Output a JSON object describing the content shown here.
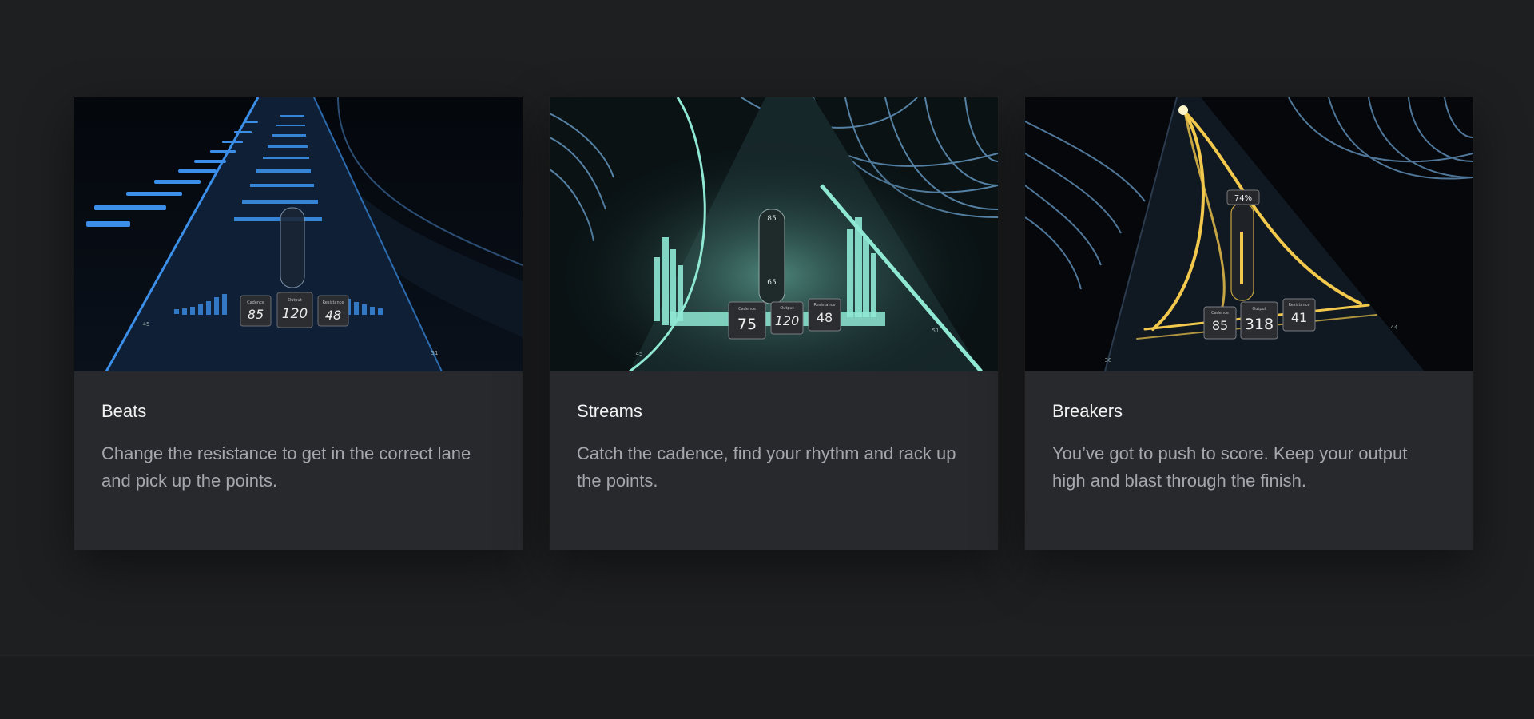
{
  "accent": {
    "beats": "#3b8fe8",
    "streams": "#8fe8d4",
    "breakers": "#f2c94c"
  },
  "cards": [
    {
      "title": "Beats",
      "description": "Change the resistance to get in the correct lane and pick up the points.",
      "hud": {
        "cadence_label": "Cadence",
        "cadence": "85",
        "output_label": "Output",
        "output": "120",
        "resistance_label": "Resistance",
        "resistance": "48",
        "marker_left": "45",
        "marker_right": "51"
      }
    },
    {
      "title": "Streams",
      "description": "Catch the cadence, find your rhythm and rack up the points.",
      "hud": {
        "cadence_label": "Cadence",
        "cadence": "75",
        "output_label": "Output",
        "output": "120",
        "resistance_label": "Resistance",
        "resistance": "48",
        "gauge_top": "85",
        "gauge_bottom": "65",
        "marker_left": "45",
        "marker_right": "51"
      }
    },
    {
      "title": "Breakers",
      "description": "You’ve got to push to score. Keep your output high and blast through the finish.",
      "hud": {
        "cadence_label": "Cadence",
        "cadence": "85",
        "output_label": "Output",
        "output": "318",
        "resistance_label": "Resistance",
        "resistance": "41",
        "percent": "74%",
        "marker_left": "38",
        "marker_right": "44"
      }
    }
  ]
}
